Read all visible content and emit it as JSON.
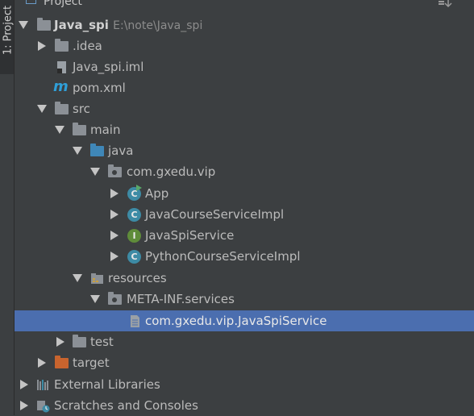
{
  "window": {
    "side_tab_label": "1: Project",
    "panel_title": "Project"
  },
  "colors": {
    "background": "#3c3f41",
    "selection": "#4b6eaf",
    "folder_source": "#3f87b8",
    "folder_excluded": "#c8642e",
    "class_icon": "#3d8ba5",
    "interface_icon": "#5f8c3a"
  },
  "tree": {
    "root": {
      "label": "Java_spi",
      "path": "E:\\note\\Java_spi"
    },
    "idea": {
      "label": ".idea"
    },
    "iml": {
      "label": "Java_spi.iml"
    },
    "pom": {
      "label": "pom.xml",
      "icon_letter": "m"
    },
    "src": {
      "label": "src"
    },
    "main": {
      "label": "main"
    },
    "java": {
      "label": "java"
    },
    "package": {
      "label": "com.gxedu.vip"
    },
    "app": {
      "label": "App",
      "icon_letter": "C"
    },
    "java_course": {
      "label": "JavaCourseServiceImpl",
      "icon_letter": "C"
    },
    "java_spi_service": {
      "label": "JavaSpiService",
      "icon_letter": "I"
    },
    "python_course": {
      "label": "PythonCourseServiceImpl",
      "icon_letter": "C"
    },
    "resources": {
      "label": "resources"
    },
    "meta_inf": {
      "label": "META-INF.services"
    },
    "service_file": {
      "label": "com.gxedu.vip.JavaSpiService"
    },
    "test": {
      "label": "test"
    },
    "target": {
      "label": "target"
    },
    "external_libraries": {
      "label": "External Libraries"
    },
    "scratches": {
      "label": "Scratches and Consoles"
    }
  }
}
